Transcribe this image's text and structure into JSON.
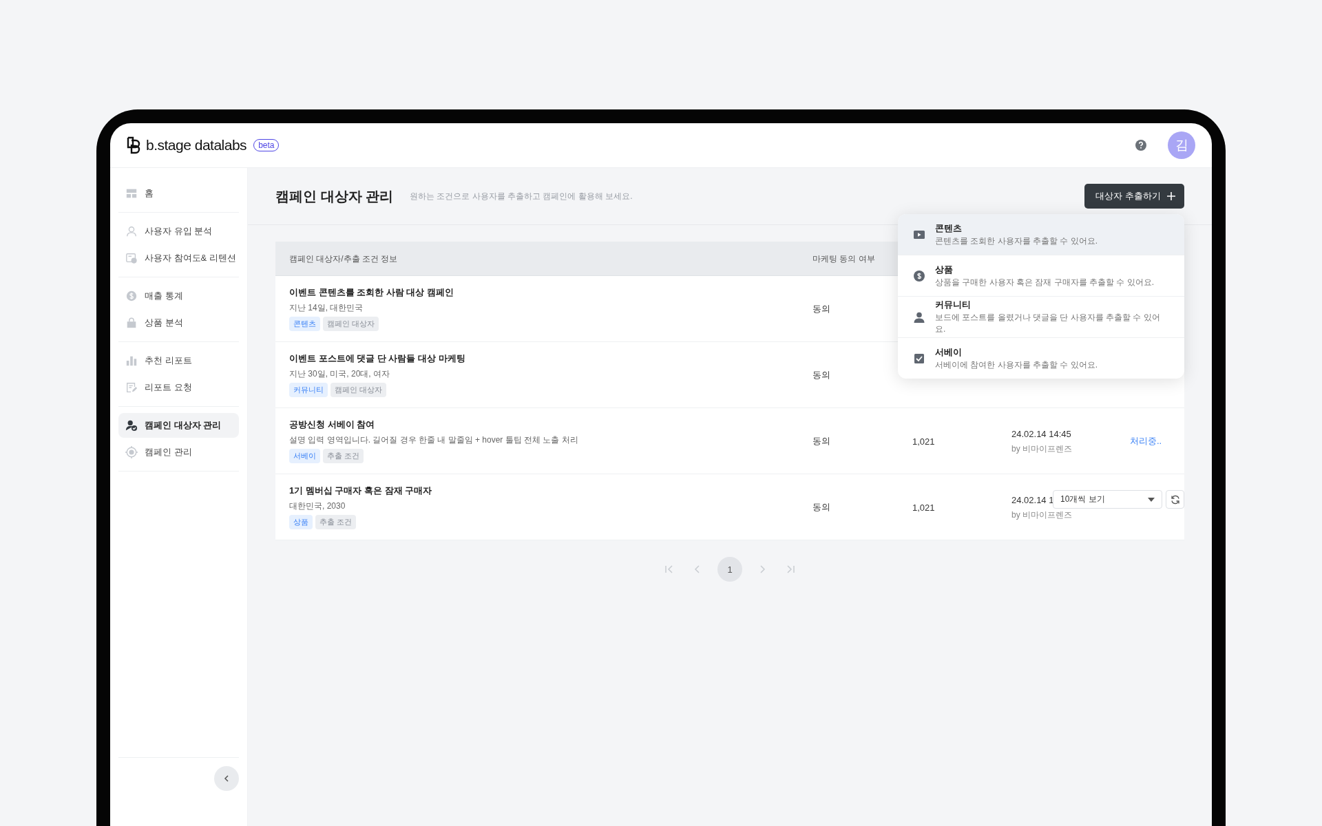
{
  "brand": {
    "name": "b.stage datalabs",
    "badge": "beta"
  },
  "header": {
    "avatar": "김"
  },
  "sidebar": {
    "groups": [
      {
        "items": [
          {
            "label": "홈",
            "selected": false
          }
        ]
      },
      {
        "items": [
          {
            "label": "사용자 유입 분석",
            "selected": false
          },
          {
            "label": "사용자 참여도& 리텐션",
            "selected": false
          }
        ]
      },
      {
        "items": [
          {
            "label": "매출 통계",
            "selected": false
          },
          {
            "label": "상품 분석",
            "selected": false
          }
        ]
      },
      {
        "items": [
          {
            "label": "추천 리포트",
            "selected": false
          },
          {
            "label": "리포트 요청",
            "selected": false
          }
        ]
      },
      {
        "items": [
          {
            "label": "캠페인 대상자 관리",
            "selected": true
          },
          {
            "label": "캠페인 관리",
            "selected": false
          }
        ]
      }
    ]
  },
  "page": {
    "title": "캠페인 대상자 관리",
    "subtitle": "원하는 조건으로 사용자를 추출하고 캠페인에 활용해 보세요.",
    "action": "대상자 추출하기"
  },
  "extract_menu": {
    "items": [
      {
        "title": "콘텐츠",
        "description": "콘텐츠를 조회한 사용자를 추출할 수 있어요.",
        "selected": true
      },
      {
        "title": "상품",
        "description": "상품을 구매한 사용자 혹은 잠재 구매자를 추출할 수 있어요.",
        "selected": false
      },
      {
        "title": "커뮤니티",
        "description": "보드에 포스트를 올렸거나 댓글을 단 사용자를 추출할 수 있어요.",
        "selected": false
      },
      {
        "title": "서베이",
        "description": "서베이에 참여한 사용자를 추출할 수 있어요.",
        "selected": false
      }
    ]
  },
  "table": {
    "columns": [
      "캠페인 대상자/추출 조건 정보",
      "마케팅 동의 여부"
    ],
    "rows": [
      {
        "title": "이벤트 콘텐츠를 조회한 사람 대상 캠페인",
        "detail": "지난 14일, 대한민국",
        "tags": [
          {
            "label": "콘텐츠",
            "kind": "category"
          },
          {
            "label": "캠페인 대상자",
            "kind": "plain"
          }
        ],
        "consent": "동의"
      },
      {
        "title": "이벤트 포스트에 댓글 단 사람들 대상 마케팅",
        "detail": "지난 30일, 미국, 20대, 여자",
        "tags": [
          {
            "label": "커뮤니티",
            "kind": "category"
          },
          {
            "label": "캠페인 대상자",
            "kind": "plain"
          }
        ],
        "consent": "동의"
      },
      {
        "title": "공방신청 서베이 참여",
        "detail": "설명 입력 영역입니다. 길어질 경우 한줄 내 말줄임 + hover 툴팁 전체 노출 처리",
        "tags": [
          {
            "label": "서베이",
            "kind": "category"
          },
          {
            "label": "추출 조건",
            "kind": "plain"
          }
        ],
        "consent": "동의",
        "count": "1,021",
        "created": "24.02.14 14:45",
        "author": "by 비마이프렌즈",
        "status": "처리중.."
      },
      {
        "title": "1기 멤버십 구매자 혹은 잠재 구매자",
        "detail": "대한민국, 2030",
        "tags": [
          {
            "label": "상품",
            "kind": "category"
          },
          {
            "label": "추출 조건",
            "kind": "plain"
          }
        ],
        "consent": "동의",
        "count": "1,021",
        "created": "24.02.14 1",
        "author": "by 비마이프렌즈"
      }
    ]
  },
  "page_size": {
    "value": "10개씩 보기"
  },
  "pagination": {
    "pages": [
      {
        "label": "1",
        "selected": true
      }
    ]
  }
}
